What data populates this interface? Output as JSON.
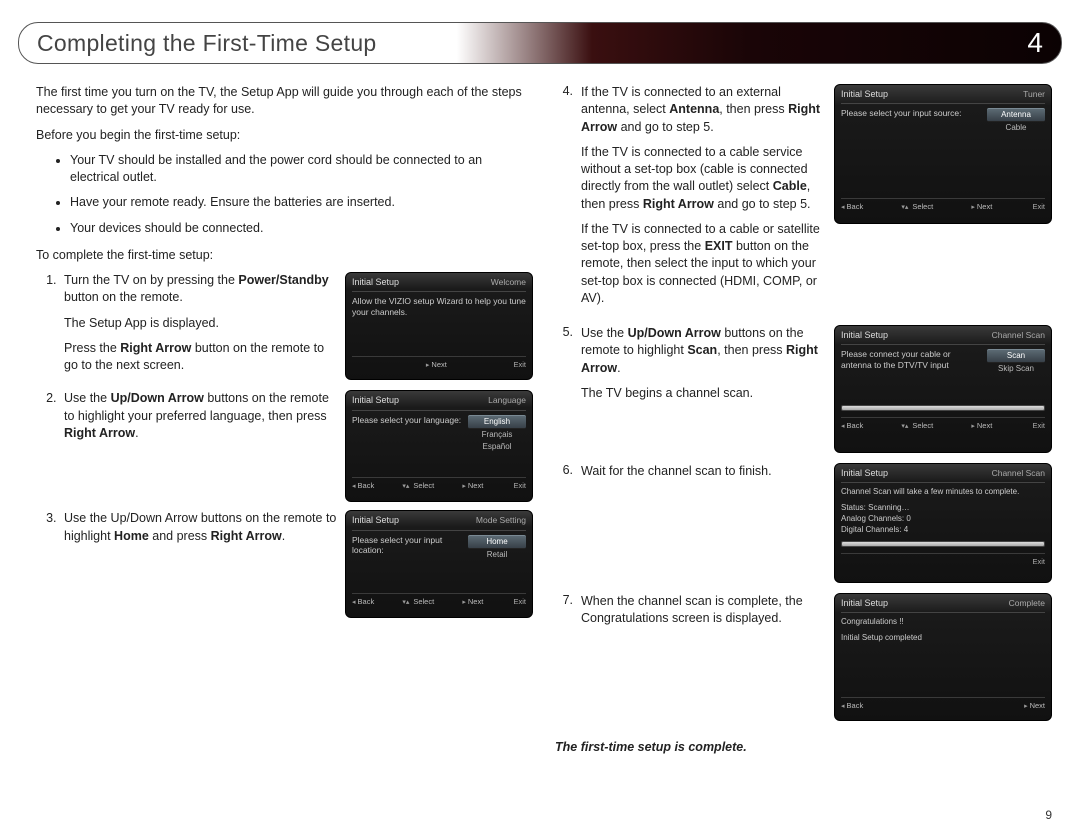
{
  "header": {
    "title": "Completing the First-Time Setup",
    "chapter": "4"
  },
  "intro": "The first time you turn on the TV, the Setup App will guide you through each of the steps necessary to get your TV ready for use.",
  "before_title": "Before you begin the first-time setup:",
  "before": [
    "Your TV should be installed and the power cord should be connected to an electrical outlet.",
    "Have your remote ready. Ensure the batteries are inserted.",
    "Your devices should be connected."
  ],
  "complete_title": "To complete the first-time setup:",
  "step1": {
    "a": "Turn the TV on by pressing the ",
    "b": "Power/Standby",
    "c": " button on the remote.",
    "d": "The Setup App is displayed.",
    "e1": "Press the ",
    "e2": "Right Arrow",
    "e3": " button on the remote to go to the next screen."
  },
  "step2": {
    "a": "Use the ",
    "b": "Up/Down Arrow",
    "c": " buttons on the remote to highlight your preferred language, then press ",
    "d": "Right Arrow",
    "e": "."
  },
  "step3": {
    "a": "Use the Up/Down Arrow buttons on the remote to highlight ",
    "b": "Home",
    "c": " and press ",
    "d": "Right Arrow",
    "e": "."
  },
  "step4": {
    "p1": {
      "a": "If the TV is connected to an external antenna, select ",
      "b": "Antenna",
      "c": ", then press ",
      "d": "Right Arrow",
      "e": " and go to step 5."
    },
    "p2": {
      "a": "If the TV is connected to a cable service without a set-top box (cable is connected directly from the wall outlet) select ",
      "b": "Cable",
      "c": ", then press ",
      "d": "Right Arrow",
      "e": " and go to step 5."
    },
    "p3": {
      "a": "If the TV is connected to a cable or satellite set-top box, press the ",
      "b": "EXIT",
      "c": " button on the remote, then select the input to which your set-top box is connected (HDMI, COMP, or AV)."
    }
  },
  "step5": {
    "a": "Use the ",
    "b": "Up/Down Arrow",
    "c": " buttons on the remote to highlight ",
    "d": "Scan",
    "e": ", then press ",
    "f": "Right Arrow",
    "g": ".",
    "h": "The TV begins a channel scan."
  },
  "step6": "Wait for the channel scan to finish.",
  "step7": "When the channel scan is complete, the Congratulations screen is displayed.",
  "done": "The first-time setup is complete.",
  "page": "9",
  "tv_common": {
    "title": "Initial Setup",
    "back": "Back",
    "select": "Select",
    "next": "Next",
    "exit": "Exit"
  },
  "tv1": {
    "sub": "Welcome",
    "prompt": "Allow the VIZIO setup Wizard to help you tune your channels."
  },
  "tv2": {
    "sub": "Language",
    "prompt": "Please select your language:",
    "opts": [
      "English",
      "Français",
      "Español"
    ]
  },
  "tv3": {
    "sub": "Mode Setting",
    "prompt": "Please select your input location:",
    "opts": [
      "Home",
      "Retail"
    ]
  },
  "tv4": {
    "sub": "Tuner",
    "prompt": "Please select your input source:",
    "opts": [
      "Antenna",
      "Cable"
    ]
  },
  "tv5": {
    "sub": "Channel Scan",
    "prompt": "Please connect your cable or antenna to the DTV/TV input",
    "opts": [
      "Scan",
      "Skip Scan"
    ]
  },
  "tv6": {
    "sub": "Channel Scan",
    "l1": "Channel Scan will take a few minutes to complete.",
    "l2": "Status: Scanning…",
    "l3": "Analog Channels: 0",
    "l4": "Digital Channels: 4"
  },
  "tv7": {
    "sub": "Complete",
    "l1": "Congratulations !!",
    "l2": "Initial Setup completed"
  }
}
